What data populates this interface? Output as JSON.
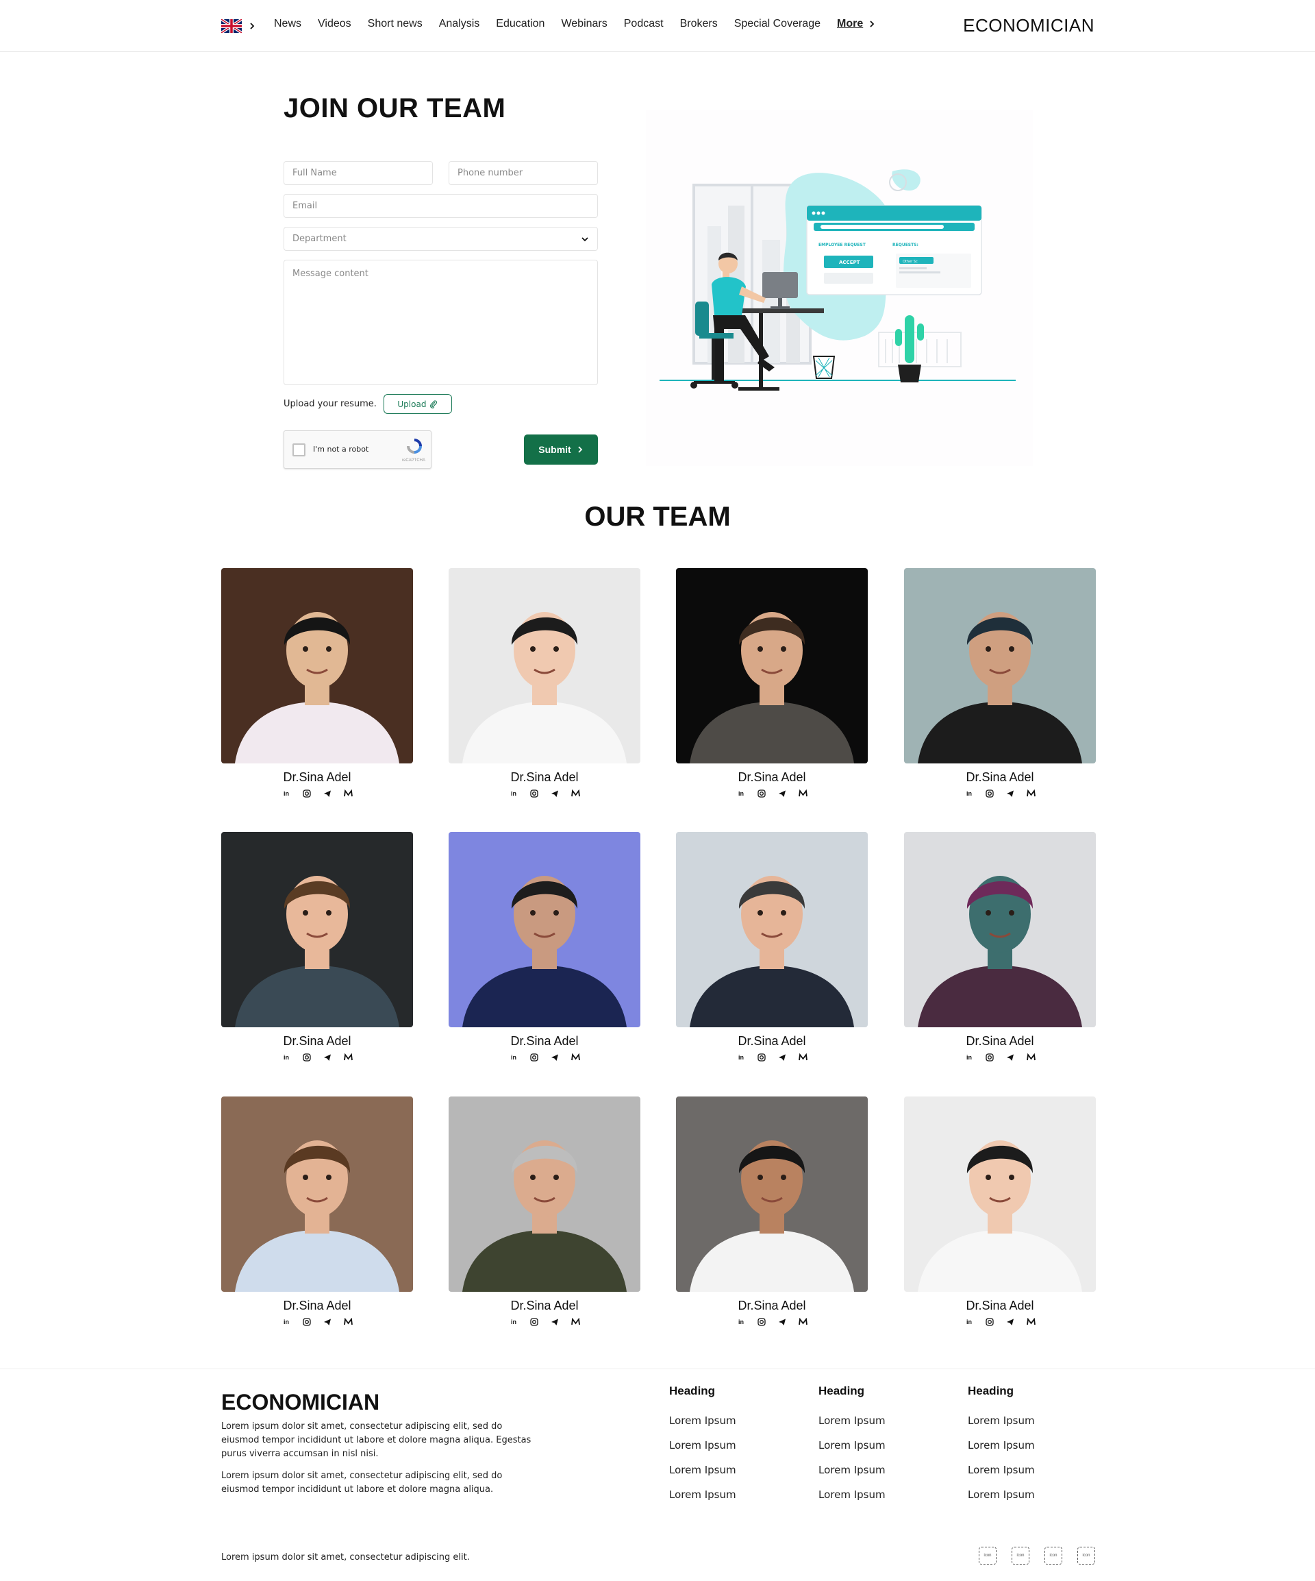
{
  "header": {
    "nav": [
      "News",
      "Videos",
      "Short news",
      "Analysis",
      "Education",
      "Webinars",
      "Podcast",
      "Brokers",
      "Special Coverage"
    ],
    "more_label": "More",
    "brand": "ECONOMICIAN"
  },
  "join": {
    "title": "JOIN OUR TEAM",
    "full_name_placeholder": "Full Name",
    "phone_placeholder": "Phone number",
    "email_placeholder": "Email",
    "department_placeholder": "Department",
    "message_placeholder": "Message content",
    "upload_label": "Upload your resume.",
    "upload_button": "Upload",
    "captcha_text": "I'm not a robot",
    "captcha_brand": "reCAPTCHA",
    "submit_label": "Submit",
    "illustration": {
      "label_employee_request": "EMPLOYEE REQUEST",
      "label_requests": "REQUESTS:",
      "accept_label": "ACCEPT",
      "other_label": "Other Sc"
    }
  },
  "team": {
    "title": "OUR TEAM",
    "members": [
      {
        "name": "Dr.Sina Adel"
      },
      {
        "name": "Dr.Sina Adel"
      },
      {
        "name": "Dr.Sina Adel"
      },
      {
        "name": "Dr.Sina Adel"
      },
      {
        "name": "Dr.Sina Adel"
      },
      {
        "name": "Dr.Sina Adel"
      },
      {
        "name": "Dr.Sina Adel"
      },
      {
        "name": "Dr.Sina Adel"
      },
      {
        "name": "Dr.Sina Adel"
      },
      {
        "name": "Dr.Sina Adel"
      },
      {
        "name": "Dr.Sina Adel"
      },
      {
        "name": "Dr.Sina Adel"
      }
    ],
    "social_icons": [
      "linkedin-icon",
      "instagram-icon",
      "telegram-icon",
      "medium-icon"
    ],
    "social_glyph_linkedin": "in"
  },
  "footer": {
    "brand": "ECONOMICIAN",
    "paragraph1": "Lorem ipsum dolor sit amet, consectetur adipiscing elit, sed do eiusmod tempor incididunt ut labore et dolore magna aliqua. Egestas purus viverra accumsan in nisl nisi.",
    "paragraph2": "Lorem ipsum dolor sit amet, consectetur adipiscing elit, sed do eiusmod tempor incididunt ut labore et dolore magna aliqua.",
    "columns": [
      {
        "heading": "Heading",
        "links": [
          "Lorem Ipsum",
          "Lorem Ipsum",
          "Lorem Ipsum",
          "Lorem Ipsum"
        ]
      },
      {
        "heading": "Heading",
        "links": [
          "Lorem Ipsum",
          "Lorem Ipsum",
          "Lorem Ipsum",
          "Lorem Ipsum"
        ]
      },
      {
        "heading": "Heading",
        "links": [
          "Lorem Ipsum",
          "Lorem Ipsum",
          "Lorem Ipsum",
          "Lorem Ipsum"
        ]
      }
    ],
    "copyright": "Lorem ipsum dolor sit amet, consectetur adipiscing elit.",
    "icon_label": "icon"
  },
  "colors": {
    "primary_green": "#137048",
    "accent_teal": "#2ec4c4"
  }
}
